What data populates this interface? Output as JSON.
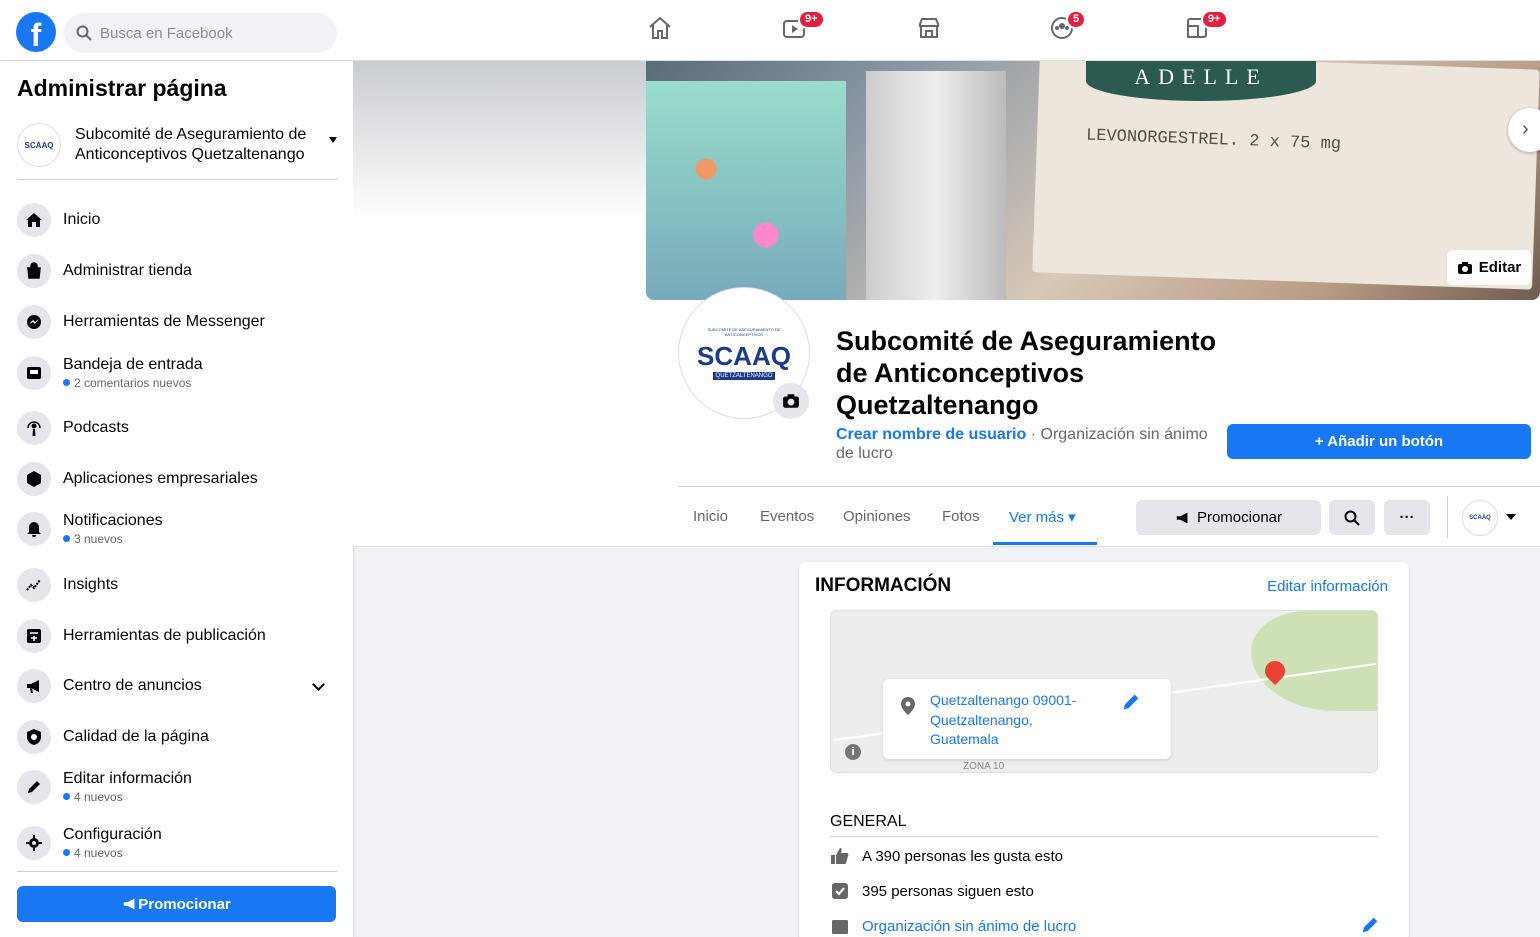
{
  "topbar": {
    "search_placeholder": "Busca en Facebook",
    "badges": {
      "watch": "9+",
      "groups": "5",
      "gaming": "9+"
    }
  },
  "sidebar": {
    "title": "Administrar página",
    "page_name": "Subcomité de Aseguramiento de Anticonceptivos Quetzaltenango",
    "items": [
      {
        "label": "Inicio",
        "sub": ""
      },
      {
        "label": "Administrar tienda",
        "sub": ""
      },
      {
        "label": "Herramientas de Messenger",
        "sub": ""
      },
      {
        "label": "Bandeja de entrada",
        "sub": "2 comentarios nuevos"
      },
      {
        "label": "Podcasts",
        "sub": ""
      },
      {
        "label": "Aplicaciones empresariales",
        "sub": ""
      },
      {
        "label": "Notificaciones",
        "sub": "3 nuevos"
      },
      {
        "label": "Insights",
        "sub": ""
      },
      {
        "label": "Herramientas de publicación",
        "sub": ""
      },
      {
        "label": "Centro de anuncios",
        "sub": ""
      },
      {
        "label": "Calidad de la página",
        "sub": ""
      },
      {
        "label": "Editar información",
        "sub": "4 nuevos"
      },
      {
        "label": "Configuración",
        "sub": "4 nuevos"
      }
    ],
    "promote_label": "Promocionar"
  },
  "cover": {
    "edit_label": "Editar",
    "brand_text": "ADELLE",
    "product_text": "LEVONORGESTREL. 2 x 75 mg"
  },
  "profile": {
    "logo_text": "SCAAQ",
    "logo_sub": "QUETZALTENANGO",
    "logo_arc": "SUBCOMITÉ DE ASEGURAMIENTO DE ANTICONCEPTIVOS",
    "name": "Subcomité de Aseguramiento de Anticonceptivos Quetzaltenango",
    "username_link": "Crear nombre de usuario",
    "category": " · Organización sin ánimo de lucro",
    "add_button": "+ Añadir un botón"
  },
  "tabs": [
    {
      "label": "Inicio"
    },
    {
      "label": "Eventos"
    },
    {
      "label": "Opiniones"
    },
    {
      "label": "Fotos"
    },
    {
      "label": "Ver más ▾"
    }
  ],
  "actions": {
    "promote": "Promocionar",
    "more": "···"
  },
  "info": {
    "title": "INFORMACIÓN",
    "edit_link": "Editar información",
    "address": "Quetzaltenango 09001-Quetzaltenango, Guatemala",
    "map_zone": "ZONA 10",
    "general_title": "GENERAL",
    "likes": "A 390 personas les gusta esto",
    "followers": "395 personas siguen esto",
    "category": "Organización sin ánimo de lucro"
  },
  "colors": {
    "accent": "#1877f2",
    "badge": "#e41e3f"
  }
}
